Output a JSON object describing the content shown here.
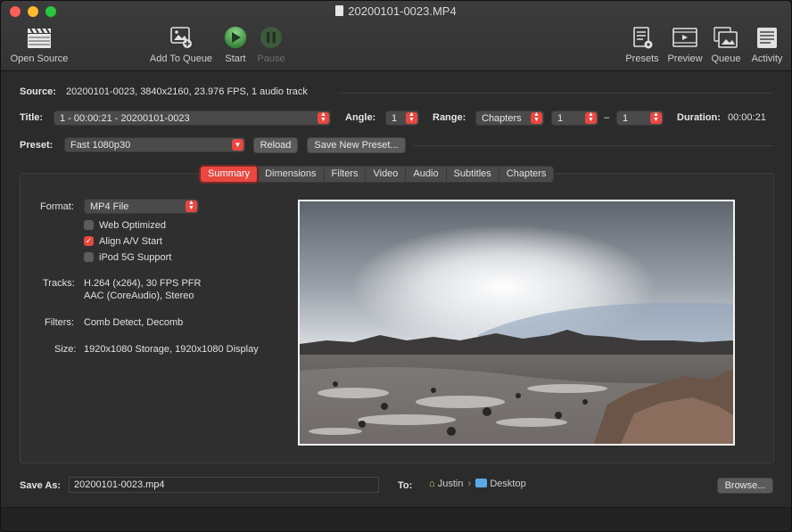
{
  "window": {
    "title": "20200101-0023.MP4"
  },
  "toolbar": {
    "open_source": "Open Source",
    "add_to_queue": "Add To Queue",
    "start": "Start",
    "pause": "Pause",
    "presets": "Presets",
    "preview": "Preview",
    "queue": "Queue",
    "activity": "Activity"
  },
  "source": {
    "label": "Source:",
    "value": "20200101-0023, 3840x2160, 23.976 FPS, 1 audio track"
  },
  "title_row": {
    "label": "Title:",
    "title_value": "1 - 00:00:21 - 20200101-0023",
    "angle_label": "Angle:",
    "angle_value": "1",
    "range_label": "Range:",
    "range_type": "Chapters",
    "range_start": "1",
    "range_sep": "–",
    "range_end": "1",
    "duration_label": "Duration:",
    "duration_value": "00:00:21"
  },
  "preset_row": {
    "label": "Preset:",
    "value": "Fast 1080p30",
    "reload": "Reload",
    "save_new": "Save New Preset..."
  },
  "tabs": [
    "Summary",
    "Dimensions",
    "Filters",
    "Video",
    "Audio",
    "Subtitles",
    "Chapters"
  ],
  "active_tab": "Summary",
  "summary": {
    "format_label": "Format:",
    "format_value": "MP4 File",
    "web_optimized": "Web Optimized",
    "web_optimized_checked": false,
    "align_av": "Align A/V Start",
    "align_av_checked": true,
    "ipod": "iPod 5G Support",
    "ipod_checked": false,
    "tracks_label": "Tracks:",
    "tracks_line1": "H.264 (x264), 30 FPS PFR",
    "tracks_line2": "AAC (CoreAudio), Stereo",
    "filters_label": "Filters:",
    "filters_value": "Comb Detect, Decomb",
    "size_label": "Size:",
    "size_value": "1920x1080 Storage, 1920x1080 Display"
  },
  "save": {
    "label": "Save As:",
    "value": "20200101-0023.mp4",
    "to_label": "To:",
    "path_user": "Justin",
    "path_sep": "›",
    "path_folder": "Desktop",
    "browse": "Browse..."
  },
  "colors": {
    "accent": "#e9473f",
    "background": "#2b2b2b"
  }
}
